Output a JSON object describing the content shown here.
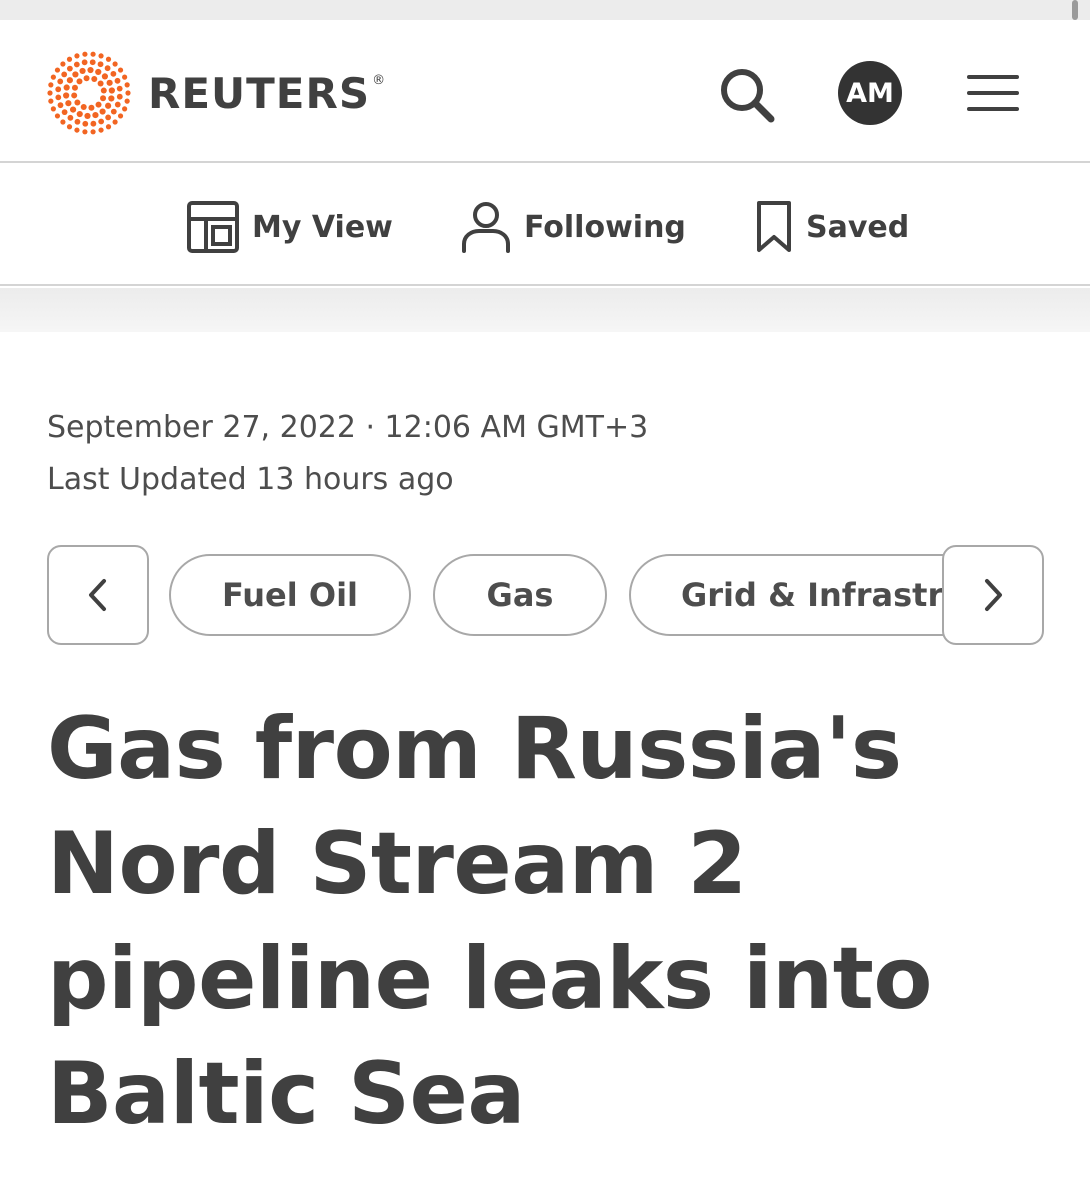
{
  "header": {
    "brand": "REUTERS",
    "registered_mark": "®",
    "avatar_initials": "AM",
    "icons": {
      "search": "search-icon",
      "menu": "hamburger-menu-icon",
      "logo": "reuters-dots-logo"
    },
    "colors": {
      "brand_orange": "#f26522",
      "text_dark": "#404040",
      "avatar_bg": "#333333"
    }
  },
  "subnav": {
    "my_view": "My View",
    "following": "Following",
    "saved": "Saved"
  },
  "article": {
    "date": "September 27, 2022 · 12:06 AM GMT+3",
    "updated": "Last Updated 13 hours ago",
    "topics": [
      "Fuel Oil",
      "Gas",
      "Grid & Infrastructure"
    ],
    "headline": "Gas from Russia's Nord Stream 2 pipeline leaks into Baltic Sea"
  }
}
